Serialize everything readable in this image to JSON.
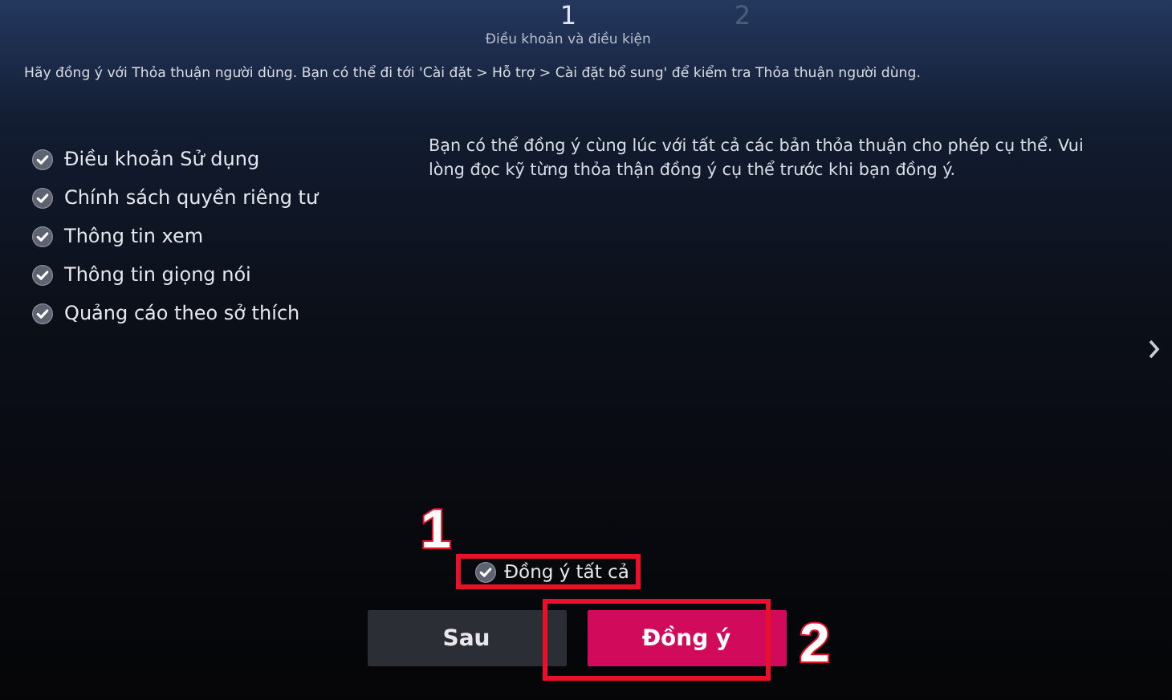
{
  "steps": [
    {
      "number": "1",
      "label": "Điều khoản và điều kiện",
      "selected": true
    },
    {
      "number": "2",
      "selected": false
    }
  ],
  "intro": "Hãy đồng ý với Thỏa thuận người dùng. Bạn có thể đi tới 'Cài đặt > Hỗ trợ > Cài đặt bổ sung' để kiểm tra Thỏa thuận người dùng.",
  "agreements": [
    {
      "label": "Điều khoản Sử dụng",
      "checked": true
    },
    {
      "label": "Chính sách quyền riêng tư",
      "checked": true
    },
    {
      "label": "Thông tin xem",
      "checked": true
    },
    {
      "label": "Thông tin giọng nói",
      "checked": true
    },
    {
      "label": "Quảng cáo theo sở thích",
      "checked": true
    }
  ],
  "description": "Bạn có thể đồng ý cùng lúc với tất cả các bản thỏa thuận cho phép cụ thể. Vui lòng đọc kỹ từng thỏa thận đồng ý cụ thể trước khi bạn đồng ý.",
  "agree_all": {
    "label": "Đồng ý tất cả",
    "checked": true
  },
  "buttons": [
    {
      "label": "Sau",
      "kind": "secondary"
    },
    {
      "label": "Đồng ý",
      "kind": "primary"
    }
  ],
  "annotations": [
    {
      "label": "1"
    },
    {
      "label": "2"
    }
  ]
}
